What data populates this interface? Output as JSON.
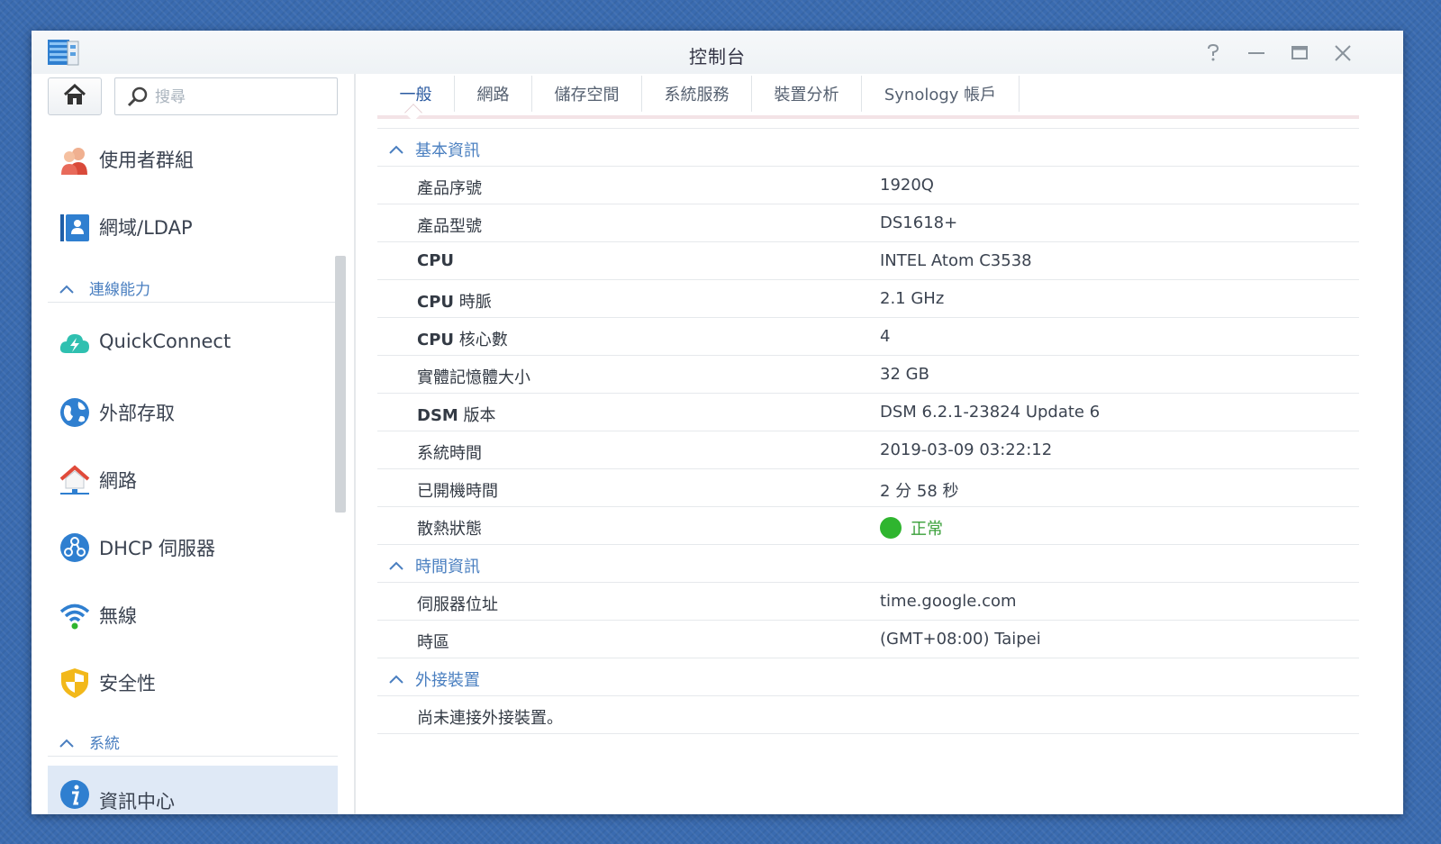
{
  "window": {
    "title": "控制台"
  },
  "sidebar": {
    "search_placeholder": "搜尋",
    "items_top": [
      {
        "label": "使用者群組",
        "icon": "users-icon"
      },
      {
        "label": "網域/LDAP",
        "icon": "domain-ldap-icon"
      }
    ],
    "section_connectivity": "連線能力",
    "items_connectivity": [
      {
        "label": "QuickConnect",
        "icon": "quickconnect-icon"
      },
      {
        "label": "外部存取",
        "icon": "globe-icon"
      },
      {
        "label": "網路",
        "icon": "network-house-icon"
      },
      {
        "label": "DHCP 伺服器",
        "icon": "dhcp-icon"
      },
      {
        "label": "無線",
        "icon": "wifi-icon"
      },
      {
        "label": "安全性",
        "icon": "shield-icon"
      }
    ],
    "section_system": "系統",
    "items_system": [
      {
        "label": "資訊中心",
        "icon": "info-icon",
        "active": true
      }
    ]
  },
  "tabs": [
    "一般",
    "網路",
    "儲存空間",
    "系統服務",
    "裝置分析",
    "Synology 帳戶"
  ],
  "active_tab": "一般",
  "sections": {
    "basic": {
      "title": "基本資訊",
      "rows": [
        {
          "key": "產品序號",
          "value": "1920Q"
        },
        {
          "key": "產品型號",
          "value": "DS1618+"
        },
        {
          "key_bold": "CPU",
          "key": "",
          "value": "INTEL Atom C3538"
        },
        {
          "key_bold": "CPU",
          "key": " 時脈",
          "value": "2.1 GHz"
        },
        {
          "key_bold": "CPU",
          "key": " 核心數",
          "value": "4"
        },
        {
          "key": "實體記憶體大小",
          "value": "32 GB"
        },
        {
          "key_bold": "DSM",
          "key": " 版本",
          "value": "DSM 6.2.1-23824 Update 6"
        },
        {
          "key": "系統時間",
          "value": "2019-03-09 03:22:12"
        },
        {
          "key": "已開機時間",
          "value": "2 分 58 秒"
        },
        {
          "key": "散熱狀態",
          "value": "正常",
          "status_color": "#2fb52f"
        }
      ]
    },
    "time": {
      "title": "時間資訊",
      "rows": [
        {
          "key": "伺服器位址",
          "value": "time.google.com"
        },
        {
          "key": "時區",
          "value": "(GMT+08:00) Taipei"
        }
      ]
    },
    "external": {
      "title": "外接裝置",
      "message": "尚未連接外接裝置。"
    }
  },
  "colors": {
    "accent": "#4a7fc0",
    "active_bg": "#dfe9f6",
    "ok": "#2fb52f"
  }
}
